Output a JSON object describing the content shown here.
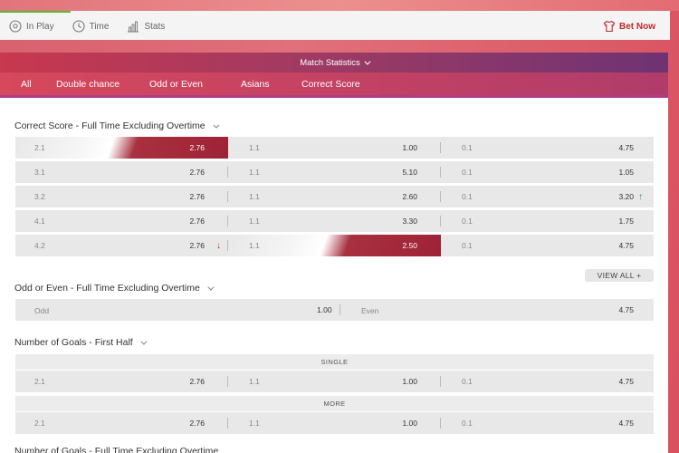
{
  "topbar": {
    "tabs": [
      {
        "label": "In Play",
        "icon": "soccer-ball-icon"
      },
      {
        "label": "Time",
        "icon": "clock-icon"
      },
      {
        "label": "Stats",
        "icon": "bar-chart-icon"
      }
    ],
    "bet_now": "Bet Now",
    "accent": "#c0272d",
    "active_color": "#5bbb2e"
  },
  "stats_bar": {
    "label": "Match Statistics"
  },
  "market_tabs": [
    "All",
    "Double chance",
    "Odd or Even",
    "Asians",
    "Correct Score"
  ],
  "correct_score": {
    "title": "Correct Score - Full Time Excluding Overtime",
    "rows": [
      [
        {
          "label": "2.1",
          "value": "2.76"
        },
        {
          "label": "1.1",
          "value": "1.00"
        },
        {
          "label": "0.1",
          "value": "4.75"
        }
      ],
      [
        {
          "label": "3.1",
          "value": "2.76"
        },
        {
          "label": "1.1",
          "value": "5.10"
        },
        {
          "label": "0.1",
          "value": "1.05"
        }
      ],
      [
        {
          "label": "3.2",
          "value": "2.76"
        },
        {
          "label": "1.1",
          "value": "2.60"
        },
        {
          "label": "0.1",
          "value": "3.20"
        }
      ],
      [
        {
          "label": "4.1",
          "value": "2.76"
        },
        {
          "label": "1.1",
          "value": "3.30"
        },
        {
          "label": "0.1",
          "value": "1.75"
        }
      ],
      [
        {
          "label": "4.2",
          "value": "2.76"
        },
        {
          "label": "1.1",
          "value": "2.50"
        },
        {
          "label": "0.1",
          "value": "4.75"
        }
      ]
    ],
    "view_all": "VIEW ALL +"
  },
  "odd_even": {
    "title": "Odd or Even - Full Time Excluding Overtime",
    "odd_label": "Odd",
    "odd_value": "1.00",
    "even_label": "Even",
    "even_value": "4.75"
  },
  "goals_first_half": {
    "title": "Number of Goals - First Half",
    "single_label": "SINGLE",
    "single_row": [
      {
        "label": "2.1",
        "value": "2.76"
      },
      {
        "label": "1.1",
        "value": "1.00"
      },
      {
        "label": "0.1",
        "value": "4.75"
      }
    ],
    "more_label": "MORE",
    "more_row": [
      {
        "label": "2.1",
        "value": "2.76"
      },
      {
        "label": "1.1",
        "value": "1.00"
      },
      {
        "label": "0.1",
        "value": "4.75"
      }
    ]
  },
  "cutoff_title": "Number of Goals - Full Time Excluding Overtime"
}
